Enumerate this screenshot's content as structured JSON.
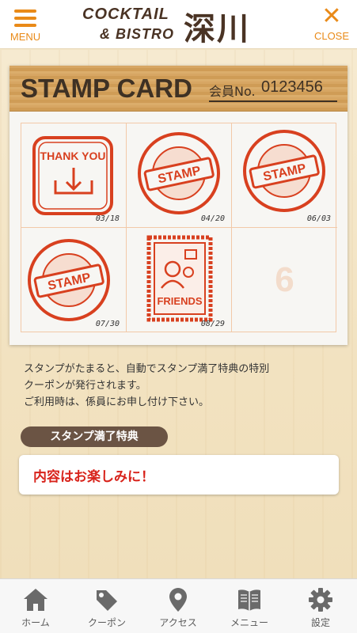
{
  "header": {
    "menu_label": "MENU",
    "close_label": "CLOSE",
    "logo_line1": "COCKTAIL",
    "logo_line2": "& BISTRO",
    "logo_jp": "深川",
    "accent_color": "#e98a18"
  },
  "card": {
    "title": "STAMP CARD",
    "member_label": "会員No.",
    "member_number": "0123456",
    "cells": [
      {
        "index": 1,
        "stamp": "thank-you",
        "stamp_text": "THANK YOU",
        "date": "03/18"
      },
      {
        "index": 2,
        "stamp": "round-stamp",
        "stamp_text": "STAMP",
        "date": "04/20"
      },
      {
        "index": 3,
        "stamp": "round-stamp",
        "stamp_text": "STAMP",
        "date": "06/03"
      },
      {
        "index": 4,
        "stamp": "round-stamp",
        "stamp_text": "STAMP",
        "date": "07/30"
      },
      {
        "index": 5,
        "stamp": "friends",
        "stamp_text": "FRIENDS",
        "date": "08/29"
      },
      {
        "index": 6,
        "stamp": null,
        "stamp_text": "",
        "date": "",
        "placeholder_number": "6"
      }
    ],
    "stamp_color": "#d8401f"
  },
  "info": {
    "line1": "スタンプがたまると、自動でスタンプ満了特典の特別",
    "line2": "クーポンが発行されます。",
    "line3": "ご利用時は、係員にお申し付け下さい。"
  },
  "benefit": {
    "section_title": "スタンプ満了特典",
    "content": "内容はお楽しみに！",
    "content_color": "#d8231b"
  },
  "tabbar": {
    "items": [
      {
        "label": "ホーム",
        "icon": "home-icon"
      },
      {
        "label": "クーポン",
        "icon": "coupon-tag-icon"
      },
      {
        "label": "アクセス",
        "icon": "map-pin-icon"
      },
      {
        "label": "メニュー",
        "icon": "menu-book-icon"
      },
      {
        "label": "設定",
        "icon": "gear-icon"
      }
    ]
  }
}
